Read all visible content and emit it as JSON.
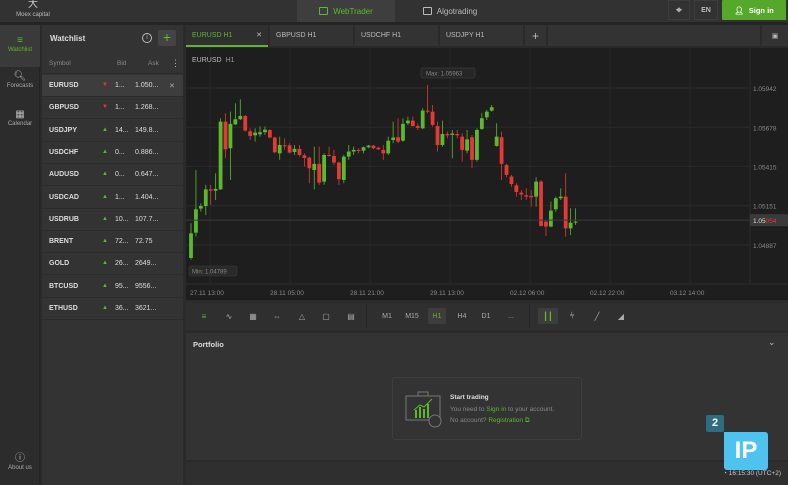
{
  "topbar": {
    "logo_text": "Moex capital",
    "tabs": [
      {
        "label": "WebTrader",
        "icon": "chart-box-icon",
        "active": true
      },
      {
        "label": "Algotrading",
        "icon": "robot-box-icon",
        "active": false
      }
    ],
    "language": "EN",
    "sign_in": "Sign in"
  },
  "leftnav": {
    "items": [
      {
        "label": "Watchlist",
        "icon": "list-icon",
        "active": true
      },
      {
        "label": "Forecasts",
        "icon": "search-chart-icon"
      },
      {
        "label": "Calendar",
        "icon": "calendar-icon"
      }
    ],
    "about": "About us"
  },
  "watchlist": {
    "title": "Watchlist",
    "columns": {
      "symbol": "Symbol",
      "bid": "Bid",
      "ask": "Ask"
    },
    "rows": [
      {
        "symbol": "EURUSD",
        "dir": "down",
        "bid": "1...",
        "ask": "1.050..."
      },
      {
        "symbol": "GBPUSD",
        "dir": "down",
        "bid": "1...",
        "ask": "1.268..."
      },
      {
        "symbol": "USDJPY",
        "dir": "up",
        "bid": "14...",
        "ask": "149.8..."
      },
      {
        "symbol": "USDCHF",
        "dir": "up",
        "bid": "0...",
        "ask": "0.886..."
      },
      {
        "symbol": "AUDUSD",
        "dir": "up",
        "bid": "0...",
        "ask": "0.647..."
      },
      {
        "symbol": "USDCAD",
        "dir": "up",
        "bid": "1...",
        "ask": "1.404..."
      },
      {
        "symbol": "USDRUB",
        "dir": "up",
        "bid": "10...",
        "ask": "107.7..."
      },
      {
        "symbol": "BRENT",
        "dir": "up",
        "bid": "72...",
        "ask": "72.75"
      },
      {
        "symbol": "GOLD",
        "dir": "up",
        "bid": "26...",
        "ask": "2649..."
      },
      {
        "symbol": "BTCUSD",
        "dir": "up",
        "bid": "95...",
        "ask": "9556..."
      },
      {
        "symbol": "ETHUSD",
        "dir": "up",
        "bid": "36...",
        "ask": "3621..."
      }
    ]
  },
  "chart_tabs": [
    {
      "label": "EURUSD H1",
      "active": true
    },
    {
      "label": "GBPUSD H1"
    },
    {
      "label": "USDCHF H1"
    },
    {
      "label": "USDJPY H1"
    }
  ],
  "chart": {
    "symbol": "EURUSD",
    "timeframe": "H1",
    "max_label": "Max: 1.05963",
    "min_label": "Min: 1.04789",
    "current_price": {
      "prefix": "1.05",
      "suffix": "054"
    },
    "colors": {
      "up": "#5cb82c",
      "down": "#e53935"
    }
  },
  "chart_data": {
    "type": "candlestick",
    "y_ticks": [
      "1.05942",
      "1.05678",
      "1.05415",
      "1.05151",
      "1.04887"
    ],
    "x_ticks": [
      "27.11 13:00",
      "28.11 05:00",
      "28.11 21:00",
      "29.11 13:00",
      "02.12 06:00",
      "02.12 22:00",
      "03.12 14:00"
    ],
    "ohlc": [
      [
        1.048,
        1.05033,
        1.04789,
        1.04965
      ],
      [
        1.0497,
        1.05391,
        1.04943,
        1.05127
      ],
      [
        1.05132,
        1.05167,
        1.05111,
        1.05149
      ],
      [
        1.05149,
        1.05291,
        1.05089,
        1.05261
      ],
      [
        1.05261,
        1.05291,
        1.05156,
        1.05252
      ],
      [
        1.05252,
        1.05369,
        1.0519,
        1.05264
      ],
      [
        1.05261,
        1.05739,
        1.05257,
        1.05716
      ],
      [
        1.05716,
        1.05772,
        1.0547,
        1.0553
      ],
      [
        1.05537,
        1.05783,
        1.05324,
        1.05701
      ],
      [
        1.05698,
        1.05839,
        1.05694,
        1.05732
      ],
      [
        1.05732,
        1.05866,
        1.05727,
        1.05754
      ],
      [
        1.05754,
        1.05761,
        1.05649,
        1.05656
      ],
      [
        1.05651,
        1.05671,
        1.05593,
        1.0562
      ],
      [
        1.05624,
        1.05671,
        1.05582,
        1.05642
      ],
      [
        1.05631,
        1.05683,
        1.05615,
        1.05645
      ],
      [
        1.05645,
        1.05683,
        1.05627,
        1.05662
      ],
      [
        1.0566,
        1.05665,
        1.05604,
        1.05609
      ],
      [
        1.05609,
        1.05615,
        1.05503,
        1.0551
      ],
      [
        1.05503,
        1.05615,
        1.05459,
        1.05559
      ],
      [
        1.05557,
        1.05604,
        1.05526,
        1.05553
      ],
      [
        1.05557,
        1.05571,
        1.05503,
        1.05508
      ],
      [
        1.05512,
        1.05559,
        1.05492,
        1.05533
      ],
      [
        1.05533,
        1.05559,
        1.05481,
        1.05492
      ],
      [
        1.0549,
        1.05503,
        1.05414,
        1.05472
      ],
      [
        1.05474,
        1.05481,
        1.05302,
        1.05403
      ],
      [
        1.05391,
        1.05548,
        1.05261,
        1.05432
      ],
      [
        1.05432,
        1.05548,
        1.05291,
        1.05306
      ],
      [
        1.05313,
        1.05503,
        1.05291,
        1.05492
      ],
      [
        1.05492,
        1.05548,
        1.05481,
        1.05485
      ],
      [
        1.05485,
        1.05526,
        1.05425,
        1.05441
      ],
      [
        1.05441,
        1.05447,
        1.05291,
        1.05329
      ],
      [
        1.05324,
        1.05492,
        1.05302,
        1.05481
      ],
      [
        1.05481,
        1.05559,
        1.05459,
        1.05515
      ],
      [
        1.05515,
        1.05548,
        1.05492,
        1.05526
      ],
      [
        1.05526,
        1.05537,
        1.05503,
        1.05519
      ],
      [
        1.05521,
        1.05548,
        1.05503,
        1.05544
      ],
      [
        1.05544,
        1.05559,
        1.05537,
        1.05555
      ],
      [
        1.05555,
        1.05559,
        1.0553,
        1.05537
      ],
      [
        1.05541,
        1.05548,
        1.05526,
        1.0553
      ],
      [
        1.05526,
        1.05559,
        1.05459,
        1.05503
      ],
      [
        1.05503,
        1.05615,
        1.05492,
        1.05588
      ],
      [
        1.05593,
        1.05716,
        1.05571,
        1.05609
      ],
      [
        1.05611,
        1.05739,
        1.05571,
        1.05582
      ],
      [
        1.05588,
        1.05739,
        1.05582,
        1.05701
      ],
      [
        1.05705,
        1.0575,
        1.05694,
        1.05723
      ],
      [
        1.05723,
        1.0575,
        1.05683,
        1.05687
      ],
      [
        1.05687,
        1.05705,
        1.0566,
        1.05674
      ],
      [
        1.05671,
        1.05806,
        1.05665,
        1.0579
      ],
      [
        1.0579,
        1.05963,
        1.05772,
        1.05783
      ],
      [
        1.05783,
        1.05828,
        1.05683,
        1.05694
      ],
      [
        1.05687,
        1.05716,
        1.05515,
        1.05559
      ],
      [
        1.05559,
        1.05723,
        1.05548,
        1.05633
      ],
      [
        1.05633,
        1.05649,
        1.05604,
        1.05624
      ],
      [
        1.05627,
        1.0566,
        1.0547,
        1.05636
      ],
      [
        1.05633,
        1.0566,
        1.05604,
        1.05624
      ],
      [
        1.05615,
        1.05638,
        1.05447,
        1.05526
      ],
      [
        1.05521,
        1.0566,
        1.05503,
        1.05597
      ],
      [
        1.05611,
        1.05627,
        1.05403,
        1.05459
      ],
      [
        1.05459,
        1.05671,
        1.05447,
        1.0566
      ],
      [
        1.05667,
        1.05772,
        1.0566,
        1.05739
      ],
      [
        1.05745,
        1.05795,
        1.05727,
        1.05783
      ],
      [
        1.0579,
        1.05828,
        1.05783,
        1.05813
      ],
      [
        1.05553,
        1.05705,
        1.05548,
        1.05615
      ],
      [
        1.05611,
        1.05649,
        1.05324,
        1.05432
      ],
      [
        1.05425,
        1.05432,
        1.05342,
        1.05358
      ],
      [
        1.05347,
        1.05358,
        1.05279,
        1.05297
      ],
      [
        1.05288,
        1.05302,
        1.05212,
        1.05243
      ],
      [
        1.05239,
        1.05257,
        1.0519,
        1.05226
      ],
      [
        1.05221,
        1.05268,
        1.0519,
        1.05212
      ],
      [
        1.05217,
        1.05257,
        1.05145,
        1.05208
      ],
      [
        1.05212,
        1.05342,
        1.05145,
        1.05313
      ],
      [
        1.05313,
        1.05324,
        1.05011,
        1.05015
      ],
      [
        1.05044,
        1.05055,
        1.04948,
        1.05011
      ],
      [
        1.05011,
        1.05179,
        1.05006,
        1.05118
      ],
      [
        1.05127,
        1.05212,
        1.05111,
        1.05201
      ],
      [
        1.05201,
        1.05268,
        1.0519,
        1.05212
      ],
      [
        1.05212,
        1.05369,
        1.04943,
        1.04999
      ],
      [
        1.04999,
        1.05134,
        1.04954,
        1.05037
      ],
      [
        1.05037,
        1.05134,
        1.05022,
        1.05044
      ]
    ],
    "grid": true
  },
  "toolbar": {
    "tools": [
      "quotes-icon",
      "indicators-icon",
      "calendar-icon",
      "range-icon",
      "shapes-icon",
      "crop-icon",
      "template-icon"
    ],
    "timeframes": [
      "M1",
      "M15",
      "H1",
      "H4",
      "D1",
      "..."
    ],
    "active_timeframe": "H1",
    "chart_types": [
      "candles-icon",
      "bars-icon",
      "line-icon",
      "area-icon"
    ]
  },
  "portfolio": {
    "title": "Portfolio",
    "card": {
      "title": "Start trading",
      "line1_a": "You need to ",
      "line1_link": "Sign in",
      "line1_b": " to your account.",
      "line2_a": "No account? ",
      "line2_link": "Registration"
    }
  },
  "status": {
    "time": "16:15:30 (UTC+2)"
  },
  "watermark": {
    "badge": "2",
    "text": "IP"
  }
}
